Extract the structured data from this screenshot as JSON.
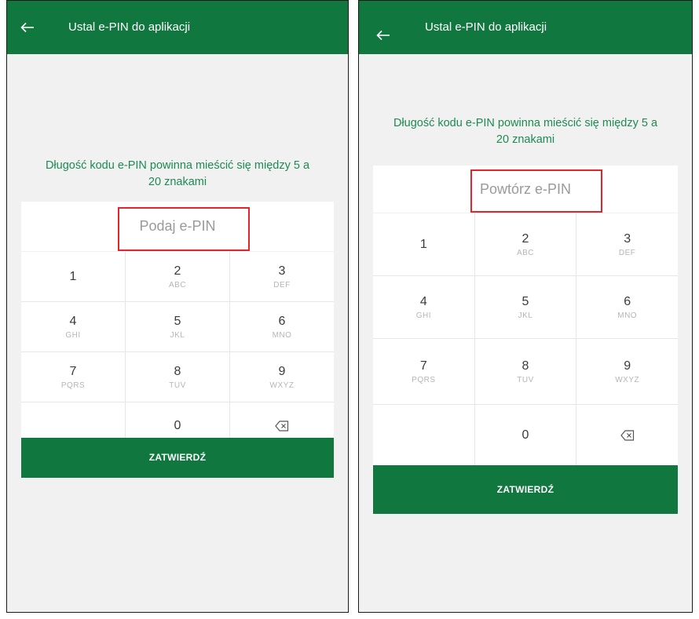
{
  "screens": [
    {
      "title": "Ustal e-PIN do aplikacji",
      "info_text": "Długość kodu e-PIN powinna mieścić się między 5 a 20 znakami",
      "pin_placeholder": "Podaj e-PIN",
      "keys": [
        {
          "digit": "1",
          "letters": ""
        },
        {
          "digit": "2",
          "letters": "ABC"
        },
        {
          "digit": "3",
          "letters": "DEF"
        },
        {
          "digit": "4",
          "letters": "GHI"
        },
        {
          "digit": "5",
          "letters": "JKL"
        },
        {
          "digit": "6",
          "letters": "MNO"
        },
        {
          "digit": "7",
          "letters": "PQRS"
        },
        {
          "digit": "8",
          "letters": "TUV"
        },
        {
          "digit": "9",
          "letters": "WXYZ"
        },
        {
          "digit": "0",
          "letters": ""
        }
      ],
      "confirm_label": "ZATWIERDŹ"
    },
    {
      "title": "Ustal e-PIN do aplikacji",
      "info_text": "Długość kodu e-PIN powinna mieścić się między 5 a 20 znakami",
      "pin_placeholder": "Powtórz e-PIN",
      "keys": [
        {
          "digit": "1",
          "letters": ""
        },
        {
          "digit": "2",
          "letters": "ABC"
        },
        {
          "digit": "3",
          "letters": "DEF"
        },
        {
          "digit": "4",
          "letters": "GHI"
        },
        {
          "digit": "5",
          "letters": "JKL"
        },
        {
          "digit": "6",
          "letters": "MNO"
        },
        {
          "digit": "7",
          "letters": "PQRS"
        },
        {
          "digit": "8",
          "letters": "TUV"
        },
        {
          "digit": "9",
          "letters": "WXYZ"
        },
        {
          "digit": "0",
          "letters": ""
        }
      ],
      "confirm_label": "ZATWIERDŹ"
    }
  ],
  "icons": {
    "back": "arrow-left-icon",
    "backspace": "backspace-icon"
  },
  "colors": {
    "brand_green": "#10773e",
    "info_text_green": "#1d8a52",
    "highlight_red": "#e5232b",
    "background": "#f1f1f1"
  }
}
